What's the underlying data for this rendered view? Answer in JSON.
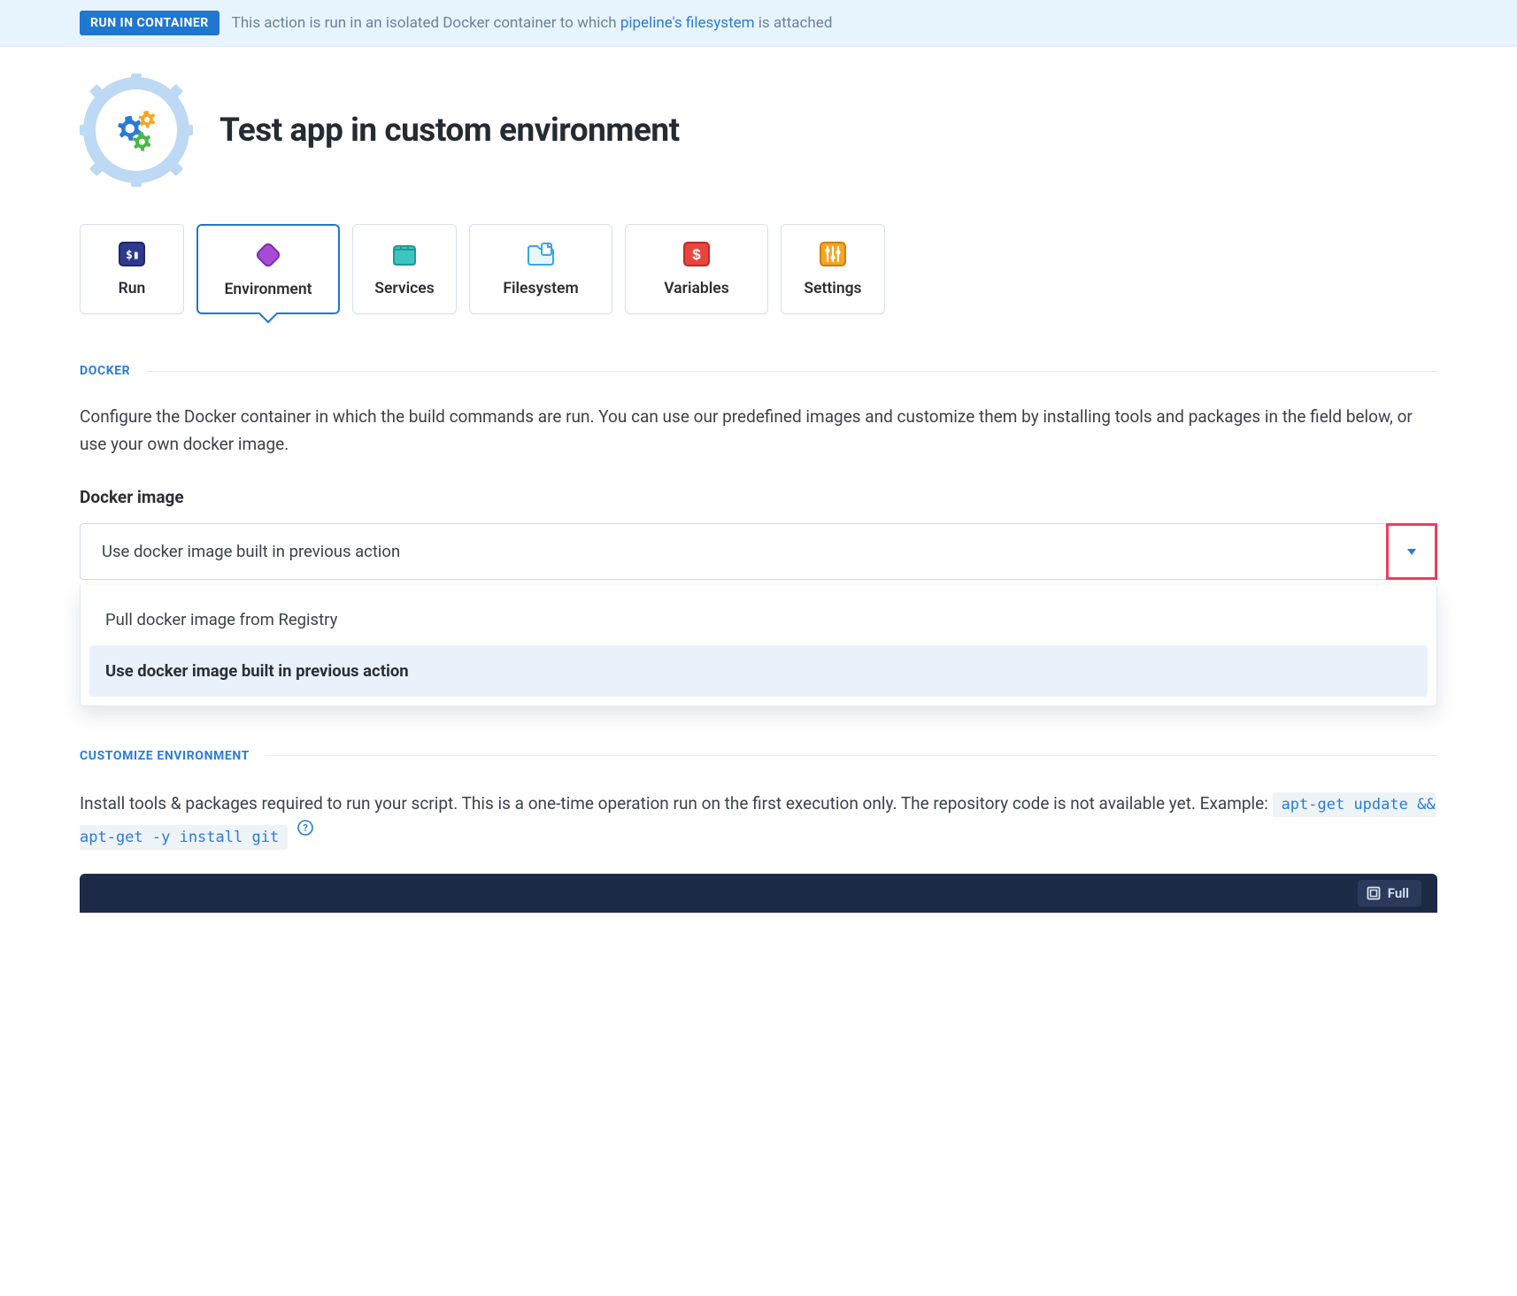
{
  "banner": {
    "badge": "RUN IN CONTAINER",
    "text_before": "This action is run in an isolated Docker container to which ",
    "link": "pipeline's filesystem",
    "text_after": " is attached"
  },
  "page_title": "Test app in custom environment",
  "tabs": [
    {
      "label": "Run"
    },
    {
      "label": "Environment"
    },
    {
      "label": "Services"
    },
    {
      "label": "Filesystem"
    },
    {
      "label": "Variables"
    },
    {
      "label": "Settings"
    }
  ],
  "docker": {
    "section": "DOCKER",
    "desc": "Configure the Docker container in which the build commands are run. You can use our predefined images and customize them by installing tools and packages in the field below, or use your own docker image.",
    "field_label": "Docker image",
    "selected": "Use docker image built in previous action",
    "options": [
      "Pull docker image from Registry",
      "Use docker image built in previous action"
    ]
  },
  "customize": {
    "section": "CUSTOMIZE ENVIRONMENT",
    "desc_a": "Install tools & packages required to run your script. This is a one-time operation run on the first execution only. The repository code is not available yet. Example: ",
    "code": "apt-get update && apt-get -y install git"
  },
  "editor": {
    "full": "Full"
  }
}
